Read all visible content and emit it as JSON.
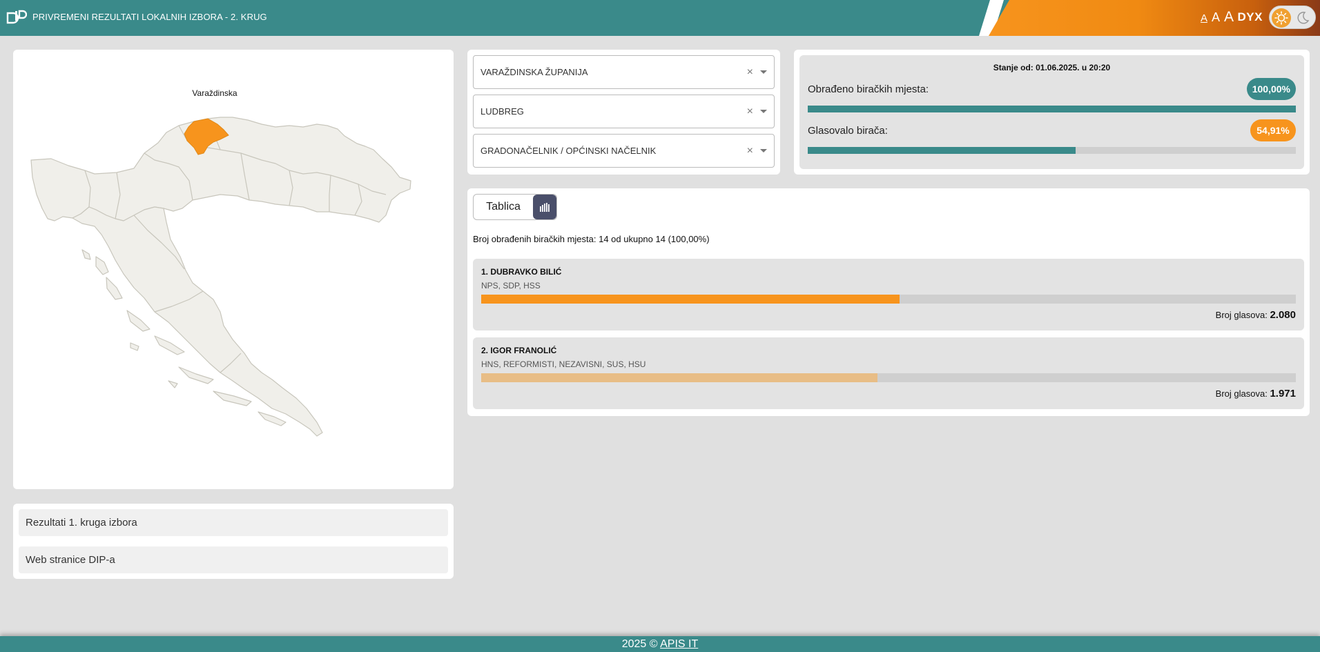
{
  "header": {
    "logo_icon": "dip-logo",
    "title": "PRIVREMENI REZULTATI LOKALNIH IZBORA - 2. KRUG",
    "font_size_small": "A",
    "font_size_medium": "A",
    "font_size_large": "A",
    "dyslexia_label": "DYX",
    "theme_icons": [
      "sun-icon",
      "moon-icon"
    ]
  },
  "map": {
    "highlighted_region": "Varaždinska",
    "highlight_color": "#f7941d",
    "base_color": "#f0efea"
  },
  "links": [
    {
      "label": "Rezultati 1. kruga izbora"
    },
    {
      "label": "Web stranice DIP-a"
    }
  ],
  "filters": [
    {
      "value": "VARAŽDINSKA ŽUPANIJA"
    },
    {
      "value": "LUDBREG"
    },
    {
      "value": "GRADONAČELNIK / OPĆINSKI NAČELNIK"
    }
  ],
  "stats": {
    "stanje": "Stanje od: 01.06.2025. u 20:20",
    "processed_label": "Obrađeno biračkih mjesta:",
    "processed_value": "100,00%",
    "processed_fraction": 1.0,
    "turnout_label": "Glasovalo birača:",
    "turnout_value": "54,91%",
    "turnout_fraction": 0.5491
  },
  "results": {
    "tab_table": "Tablica",
    "tab_chart_icon": "bar-chart-icon",
    "processed_text": "Broj obrađenih biračkih mjesta: 14 od ukupno 14 (100,00%)",
    "votes_label": "Broj glasova:",
    "candidates": [
      {
        "name": "1. DUBRAVKO BILIĆ",
        "parties": "NPS, SDP, HSS",
        "votes": "2.080",
        "vote_count": 2080,
        "color": "#f7941d"
      },
      {
        "name": "2. IGOR FRANOLIĆ",
        "parties": "HNS, REFORMISTI, NEZAVISNI, SUS, HSU",
        "votes": "1.971",
        "vote_count": 1971,
        "color": "#e8bd86"
      }
    ]
  },
  "footer": {
    "text": "2025 ©",
    "link": "APIS IT"
  }
}
